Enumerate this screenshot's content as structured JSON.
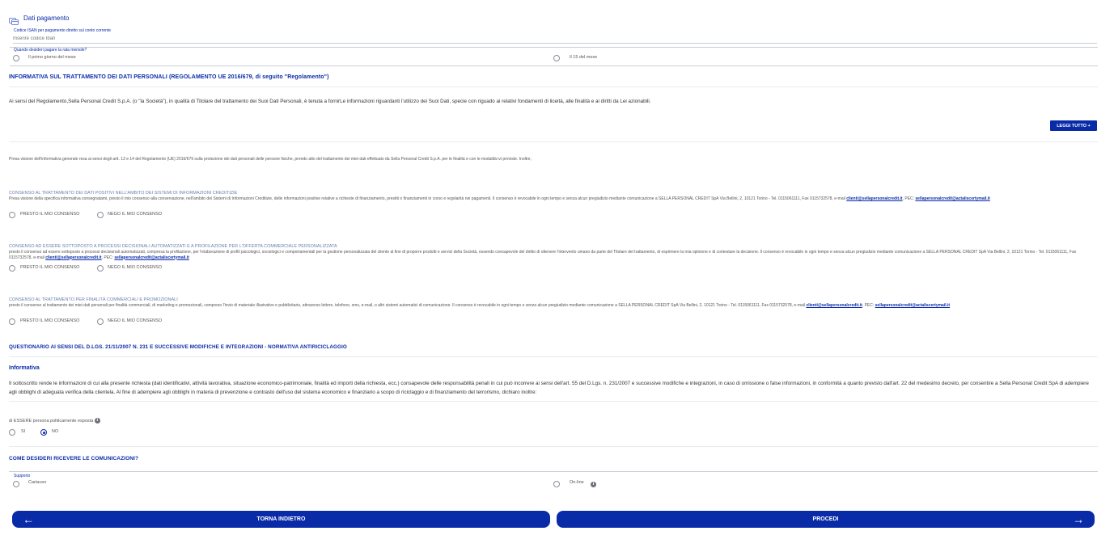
{
  "payment": {
    "title": "Dati pagamento",
    "iban_label": "Codice ISAN per pagamento diretto sul conto corrente",
    "iban_placeholder": "Inserire codice Iban",
    "rate_question": "Quando desideri pagare la rata mensile?",
    "rate_options": [
      "Il primo giorno del mese",
      "Il 15 del mese"
    ]
  },
  "privacy": {
    "heading": "INFORMATIVA SUL TRATTAMENTO DEI DATI PERSONALI (REGOLAMENTO UE 2016/679, di seguito \"Regolamento\")",
    "intro": "Ai sensi del Regolamento,Sella Personal Credit S.p.A. (o \"la Società\"), in qualità di Titolare del trattamento dei Suoi Dati Personali, è tenuta a fornirLe informazioni riguardanti l'utilizzo dei Suoi Dati, specie con riguado ai relativi fondamenti di liceità, alle finalità e ai diritti da Lei azionabili.",
    "read_all_label": "LEGGI TUTTO +",
    "acknowledgement": "Presa visione dell'informativa generale resa ai sensi degli artt. 13 e 14 del Regolamento (UE) 2016/679 sulla protezione dei dati personali delle persone fisiche, prendo atto del trattamento dei miei dati effettuato da Sella Personal Credit S.p.A. per le finalità e con le modalità ivi previste. Inoltre,"
  },
  "consents": [
    {
      "title": "CONSENSO AL TRATTAMENTO DEI DATI POSITIVI NELL'AMBITO DEI SISTEMI DI INFORMAZIONI CREDITIZIE",
      "text": "Presa visione della specifica informativa consegnatami, presto il mio consenso alla conservazione, nell'ambito dei Sistemi di Informazioni Creditizie, delle informazioni positive relative a richieste di finanziamento, prestiti o finanziamenti in corso e regolarità nei pagamenti. Il consenso è revocabile in ogni tempo e senza alcun pregiudizio mediante comunicazione a SELLA PERSONAL CREDIT SpA Via Bellini, 2, 10121 Torino - Tel. 0115061111, Fax 0115732578, e-mail",
      "email": "clienti@sellapersonalcredit.it",
      "pec_prefix": ", PEC:",
      "pec": "sellapersonalcredit@actaliscertymail.it",
      "yes": "PRESTO IL MIO CONSENSO",
      "no": "NEGO IL MIO CONSENSO"
    },
    {
      "title": "CONSENSO AD ESSERE SOTTOPOSTO A PROCESSI DECISIONALI AUTOMATIZZATI E A PROFILAZIONE PER L'OFFERTA COMMERCIALE PERSONALIZZATA",
      "text": "presto il consenso ad essere sottoposto a processi decisionali automatizzati, compresa la profilazione, per l'elaborazione di profili psicologici, sociologici e comportamentali per la gestione personalizzata del cliente al fine di proporre prodotti e servizi della Società, essendo consapevole del diritto di ottenere l'intervento umano da parte del Titolare del trattamento, di esprimere la mia opinione e di contestare la decisione. Il consenso è revocabile in ogni tempo e senza alcun pregiudizio mediante comunicazione a SELLA PERSONAL CREDIT SpA Via Bellini, 2, 10121 Torino - Tel. 0115061111, Fax 0115732578, e-mail",
      "email": "clienti@sellapersonalcredit.it",
      "pec_prefix": ", PEC:",
      "pec": "sellapersonalcredit@actaliscertymail.it",
      "yes": "PRESTO IL MIO CONSENSO",
      "no": "NEGO IL MIO CONSENSO"
    },
    {
      "title": "CONSENSO AL TRATTAMENTO PER FINALITÀ COMMERCIALI E PROMOZIONALI",
      "text": "presto il consenso al trattamento dei miei dati personali per finalità commerciali, di marketing e promozionali, compreso l'invio di materiale illustrativo e pubblicitario, attraverso lettere, telefono, sms, e-mail, o altri sistemi automatici di comunicazione. Il consenso è revocabile in ogni tempo e senza alcun pregiudizio mediante comunicazione a SELLA PERSONAL CREDIT SpA Via Bellini, 2, 10121 Torino - Tel. 0115061111, Fax 0115732578, e-mail",
      "email": "clienti@sellapersonalcredit.it",
      "pec_prefix": ", PEC:",
      "pec": "sellapersonalcredit@actaliscertymail.it",
      "yes": "PRESTO IL MIO CONSENSO",
      "no": "NEGO IL MIO CONSENSO"
    }
  ],
  "aml": {
    "heading": "QUESTIONARIO AI SENSI DEL D.LGS. 21/11/2007 N. 231 E SUCCESSIVE MODIFICHE E INTEGRAZIONI - NORMATIVA ANTIRICICLAGGIO",
    "subheading": "Informativa",
    "text": "Il sottoscritto rende le informazioni di cui alla presente richiesta (dati identificativi, attività lavorativa, situazione economico-patrimoniale, finalità ed importi della richiesta, ecc.) consapevole delle responsabilità penali in cui può incorrere ai sensi dell'art. 55 del D.Lgs. n. 231/2007 e successive modifiche e integrazioni, in caso di omissione o false informazioni, in conformità a quanto previsto dall'art. 22 del medesimo decreto, per consentire a Sella Personal Credit SpA di adempiere agli obblighi di adeguata verifica della clientela. Al fine di adempiere agli obblighi in materia di prevenzione e contrasto dell'uso del sistema economico e finanziario a scopo di riciclaggio e di finanziamento del terrorismo, dichiaro inoltre:",
    "pep_question": "di ESSERE persona politicamente esposta",
    "pep_yes": "SI",
    "pep_no": "NO",
    "pep_selected": "NO"
  },
  "communications": {
    "heading": "COME DESIDERI RICEVERE LE COMUNICAZIONI?",
    "label": "Supporto",
    "options": [
      "Cartaceo",
      "On-line"
    ]
  },
  "nav": {
    "back_label": "TORNA INDIETRO",
    "next_label": "PROCEDI"
  },
  "colors": {
    "primary": "#0a2ba8",
    "divider": "#c9cdd6"
  },
  "icons": {
    "back": "arrow-left-icon",
    "next": "arrow-right-icon",
    "info": "info-icon",
    "payment": "payment-card-icon"
  }
}
